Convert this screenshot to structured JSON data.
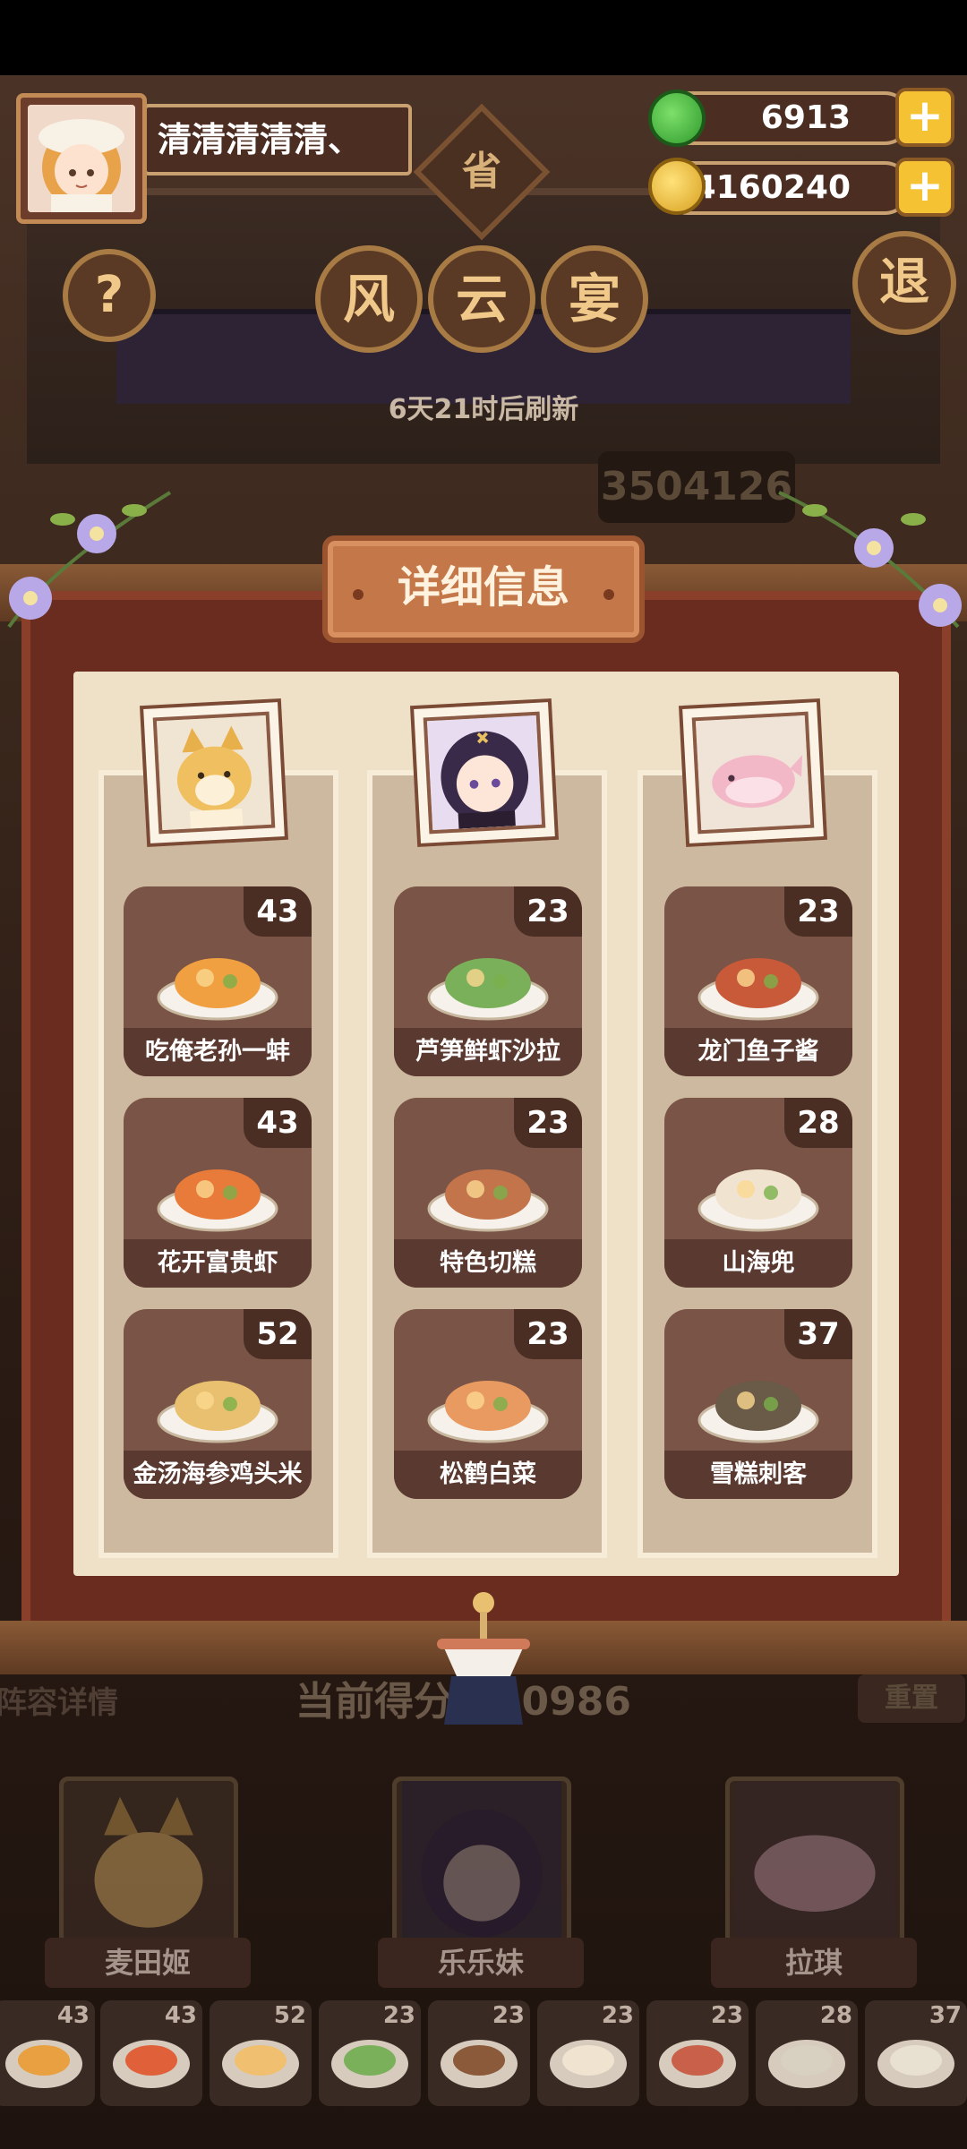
{
  "player": {
    "name": "清清清清清、"
  },
  "resources": {
    "jade": "6913",
    "coins": "4160240"
  },
  "title_chars": [
    "风",
    "云",
    "宴"
  ],
  "seal_char": "省",
  "retreat_char": "退",
  "help_char": "?",
  "refresh_text": "6天21时后刷新",
  "score_top": "3504126",
  "panel_title": "详细信息",
  "teams": [
    {
      "name": "麦田姬",
      "dishes": [
        {
          "name": "吃俺老孙一蚌",
          "count": "43"
        },
        {
          "name": "花开富贵虾",
          "count": "43"
        },
        {
          "name": "金汤海参鸡头米",
          "count": "52"
        }
      ]
    },
    {
      "name": "乐乐妹",
      "dishes": [
        {
          "name": "芦笋鲜虾沙拉",
          "count": "23"
        },
        {
          "name": "特色切糕",
          "count": "23"
        },
        {
          "name": "松鹤白菜",
          "count": "23"
        }
      ]
    },
    {
      "name": "拉琪",
      "dishes": [
        {
          "name": "龙门鱼子酱",
          "count": "23"
        },
        {
          "name": "山海兜",
          "count": "28"
        },
        {
          "name": "雪糕刺客",
          "count": "37"
        }
      ]
    }
  ],
  "bottom": {
    "lineup_label": "阵容详情",
    "current_score_label": "当前得分",
    "current_score": "940986",
    "reset_label": "重置"
  },
  "strip_counts": [
    "43",
    "43",
    "52",
    "23",
    "23",
    "23",
    "23",
    "28",
    "37"
  ],
  "colors": {
    "accent": "#c4784a",
    "gold": "#f4c233",
    "board": "#6b2c20"
  }
}
